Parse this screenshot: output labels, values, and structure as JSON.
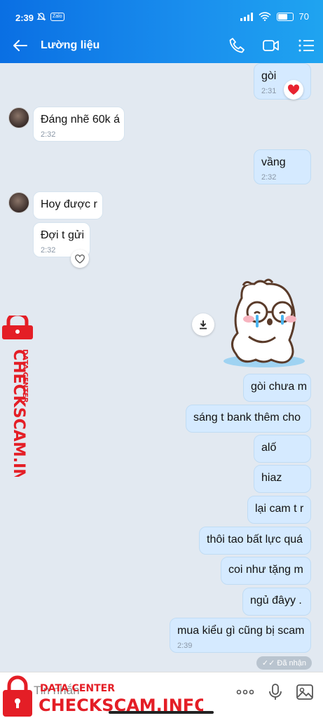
{
  "status_bar": {
    "time": "2:39",
    "app_badge": "Zalo",
    "battery": "70",
    "battery_level": 0.7
  },
  "header": {
    "title": "Lường liệu"
  },
  "messages": [
    {
      "dir": "out",
      "text": "gòi",
      "time": "2:31",
      "reaction": "heart"
    },
    {
      "dir": "in",
      "text": "Đáng nhẽ 60k á",
      "time": "2:32"
    },
    {
      "dir": "out",
      "text": "vầng",
      "time": "2:32"
    },
    {
      "dir": "in",
      "text": "Hoy được r"
    },
    {
      "dir": "in",
      "text": "Đợi t gửi",
      "time": "2:32",
      "reaction": "heart-outline"
    },
    {
      "dir": "out",
      "type": "sticker",
      "sticker": "crying-bear-with-glasses"
    },
    {
      "dir": "out",
      "text": "gòi chưa m"
    },
    {
      "dir": "out",
      "text": "sáng t bank thêm cho"
    },
    {
      "dir": "out",
      "text": "alố"
    },
    {
      "dir": "out",
      "text": "hiaz"
    },
    {
      "dir": "out",
      "text": "lại cam t r"
    },
    {
      "dir": "out",
      "text": "thôi tao bất lực quá"
    },
    {
      "dir": "out",
      "text": "coi như tặng m"
    },
    {
      "dir": "out",
      "text": "ngủ đâyy ."
    },
    {
      "dir": "out",
      "text": "mua kiểu gì cũng bị scam",
      "time": "2:39"
    }
  ],
  "seen_label": "Đã nhận",
  "input": {
    "placeholder": "Tin nhắn"
  },
  "watermark": {
    "brand": "CHECKSCAM.INFO",
    "sub": "DATA CENTER",
    "color": "#e41e26"
  },
  "colors": {
    "header": "#1a8fee",
    "outgoing": "#d5eaff",
    "incoming": "#ffffff",
    "background": "#e2e9f1"
  }
}
